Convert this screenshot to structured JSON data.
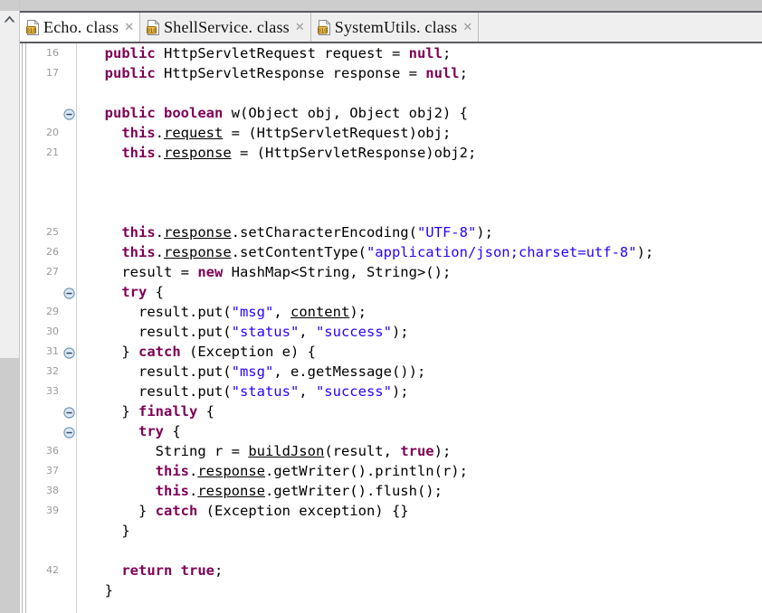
{
  "window": {
    "scroll_up_icon": "chevron-up-icon"
  },
  "tabbar": {
    "tabs": [
      {
        "label": "Echo. class",
        "icon": "class-file-icon",
        "close": "✕",
        "active": true
      },
      {
        "label": "ShellService. class",
        "icon": "class-file-icon",
        "close": "✕",
        "active": false
      },
      {
        "label": "SystemUtils. class",
        "icon": "class-file-icon",
        "close": "✕",
        "active": false
      }
    ]
  },
  "editor": {
    "colors": {
      "keyword": "#7f0055",
      "string": "#2a00ff",
      "plain": "#000000",
      "line_number": "#9b9b9b",
      "fold_marker": "#6a93b5"
    },
    "lines": [
      {
        "num": "16",
        "fold": false,
        "tokens": [
          {
            "t": "  ",
            "c": "pln"
          },
          {
            "t": "public",
            "c": "kw"
          },
          {
            "t": " HttpServletRequest request = ",
            "c": "pln"
          },
          {
            "t": "null",
            "c": "kw"
          },
          {
            "t": ";",
            "c": "pln"
          }
        ]
      },
      {
        "num": "17",
        "fold": false,
        "tokens": [
          {
            "t": "  ",
            "c": "pln"
          },
          {
            "t": "public",
            "c": "kw"
          },
          {
            "t": " HttpServletResponse response = ",
            "c": "pln"
          },
          {
            "t": "null",
            "c": "kw"
          },
          {
            "t": ";",
            "c": "pln"
          }
        ]
      },
      {
        "num": "",
        "fold": false,
        "tokens": []
      },
      {
        "num": "",
        "fold": true,
        "tokens": [
          {
            "t": "  ",
            "c": "pln"
          },
          {
            "t": "public boolean",
            "c": "kw"
          },
          {
            "t": " w(Object obj, Object obj2) {",
            "c": "pln"
          }
        ]
      },
      {
        "num": "20",
        "fold": false,
        "tokens": [
          {
            "t": "    ",
            "c": "pln"
          },
          {
            "t": "this",
            "c": "kw"
          },
          {
            "t": ".",
            "c": "pln"
          },
          {
            "t": "request",
            "c": "fld"
          },
          {
            "t": " = (HttpServletRequest)obj;",
            "c": "pln"
          }
        ]
      },
      {
        "num": "21",
        "fold": false,
        "tokens": [
          {
            "t": "    ",
            "c": "pln"
          },
          {
            "t": "this",
            "c": "kw"
          },
          {
            "t": ".",
            "c": "pln"
          },
          {
            "t": "response",
            "c": "fld"
          },
          {
            "t": " = (HttpServletResponse)obj2;",
            "c": "pln"
          }
        ]
      },
      {
        "num": "",
        "fold": false,
        "tokens": []
      },
      {
        "num": "",
        "fold": false,
        "tokens": []
      },
      {
        "num": "",
        "fold": false,
        "tokens": []
      },
      {
        "num": "25",
        "fold": false,
        "tokens": [
          {
            "t": "    ",
            "c": "pln"
          },
          {
            "t": "this",
            "c": "kw"
          },
          {
            "t": ".",
            "c": "pln"
          },
          {
            "t": "response",
            "c": "fld"
          },
          {
            "t": ".setCharacterEncoding(",
            "c": "pln"
          },
          {
            "t": "\"UTF-8\"",
            "c": "str"
          },
          {
            "t": ");",
            "c": "pln"
          }
        ]
      },
      {
        "num": "26",
        "fold": false,
        "tokens": [
          {
            "t": "    ",
            "c": "pln"
          },
          {
            "t": "this",
            "c": "kw"
          },
          {
            "t": ".",
            "c": "pln"
          },
          {
            "t": "response",
            "c": "fld"
          },
          {
            "t": ".setContentType(",
            "c": "pln"
          },
          {
            "t": "\"application/json;charset=utf-8\"",
            "c": "str"
          },
          {
            "t": ");",
            "c": "pln"
          }
        ]
      },
      {
        "num": "27",
        "fold": false,
        "tokens": [
          {
            "t": "    result = ",
            "c": "pln"
          },
          {
            "t": "new",
            "c": "kw"
          },
          {
            "t": " HashMap<String, String>();",
            "c": "pln"
          }
        ]
      },
      {
        "num": "",
        "fold": true,
        "tokens": [
          {
            "t": "    ",
            "c": "pln"
          },
          {
            "t": "try",
            "c": "kw"
          },
          {
            "t": " {",
            "c": "pln"
          }
        ]
      },
      {
        "num": "29",
        "fold": false,
        "tokens": [
          {
            "t": "      result.put(",
            "c": "pln"
          },
          {
            "t": "\"msg\"",
            "c": "str"
          },
          {
            "t": ", ",
            "c": "pln"
          },
          {
            "t": "content",
            "c": "fld"
          },
          {
            "t": ");",
            "c": "pln"
          }
        ]
      },
      {
        "num": "30",
        "fold": false,
        "tokens": [
          {
            "t": "      result.put(",
            "c": "pln"
          },
          {
            "t": "\"status\"",
            "c": "str"
          },
          {
            "t": ", ",
            "c": "pln"
          },
          {
            "t": "\"success\"",
            "c": "str"
          },
          {
            "t": ");",
            "c": "pln"
          }
        ]
      },
      {
        "num": "31",
        "fold": true,
        "tokens": [
          {
            "t": "    } ",
            "c": "pln"
          },
          {
            "t": "catch",
            "c": "kw"
          },
          {
            "t": " (Exception e) {",
            "c": "pln"
          }
        ]
      },
      {
        "num": "32",
        "fold": false,
        "tokens": [
          {
            "t": "      result.put(",
            "c": "pln"
          },
          {
            "t": "\"msg\"",
            "c": "str"
          },
          {
            "t": ", e.getMessage());",
            "c": "pln"
          }
        ]
      },
      {
        "num": "33",
        "fold": false,
        "tokens": [
          {
            "t": "      result.put(",
            "c": "pln"
          },
          {
            "t": "\"status\"",
            "c": "str"
          },
          {
            "t": ", ",
            "c": "pln"
          },
          {
            "t": "\"success\"",
            "c": "str"
          },
          {
            "t": ");",
            "c": "pln"
          }
        ]
      },
      {
        "num": "",
        "fold": true,
        "tokens": [
          {
            "t": "    } ",
            "c": "pln"
          },
          {
            "t": "finally",
            "c": "kw"
          },
          {
            "t": " {",
            "c": "pln"
          }
        ]
      },
      {
        "num": "",
        "fold": true,
        "tokens": [
          {
            "t": "      ",
            "c": "pln"
          },
          {
            "t": "try",
            "c": "kw"
          },
          {
            "t": " {",
            "c": "pln"
          }
        ]
      },
      {
        "num": "36",
        "fold": false,
        "tokens": [
          {
            "t": "        String r = ",
            "c": "pln"
          },
          {
            "t": "buildJson",
            "c": "fld"
          },
          {
            "t": "(result, ",
            "c": "pln"
          },
          {
            "t": "true",
            "c": "kw"
          },
          {
            "t": ");",
            "c": "pln"
          }
        ]
      },
      {
        "num": "37",
        "fold": false,
        "tokens": [
          {
            "t": "        ",
            "c": "pln"
          },
          {
            "t": "this",
            "c": "kw"
          },
          {
            "t": ".",
            "c": "pln"
          },
          {
            "t": "response",
            "c": "fld"
          },
          {
            "t": ".getWriter().println(r);",
            "c": "pln"
          }
        ]
      },
      {
        "num": "38",
        "fold": false,
        "tokens": [
          {
            "t": "        ",
            "c": "pln"
          },
          {
            "t": "this",
            "c": "kw"
          },
          {
            "t": ".",
            "c": "pln"
          },
          {
            "t": "response",
            "c": "fld"
          },
          {
            "t": ".getWriter().flush();",
            "c": "pln"
          }
        ]
      },
      {
        "num": "39",
        "fold": false,
        "tokens": [
          {
            "t": "      } ",
            "c": "pln"
          },
          {
            "t": "catch",
            "c": "kw"
          },
          {
            "t": " (Exception exception) {}",
            "c": "pln"
          }
        ]
      },
      {
        "num": "",
        "fold": false,
        "tokens": [
          {
            "t": "    }",
            "c": "pln"
          }
        ]
      },
      {
        "num": "",
        "fold": false,
        "tokens": []
      },
      {
        "num": "42",
        "fold": false,
        "tokens": [
          {
            "t": "    ",
            "c": "pln"
          },
          {
            "t": "return true",
            "c": "kw"
          },
          {
            "t": ";",
            "c": "pln"
          }
        ]
      },
      {
        "num": "",
        "fold": false,
        "tokens": [
          {
            "t": "  }",
            "c": "pln"
          }
        ]
      }
    ]
  }
}
